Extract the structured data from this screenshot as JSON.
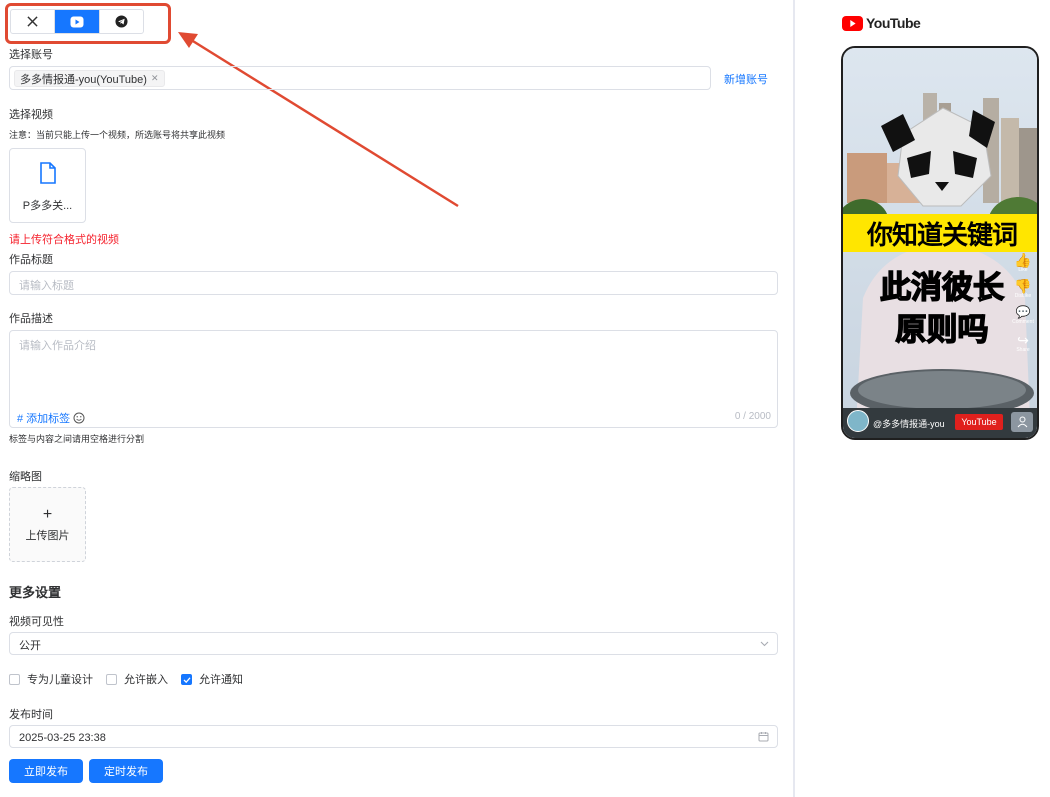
{
  "platforms": [
    {
      "name": "x",
      "icon": "x-logo-icon",
      "active": false
    },
    {
      "name": "youtube",
      "icon": "youtube-play-icon",
      "active": true
    },
    {
      "name": "telegram",
      "icon": "telegram-icon",
      "active": false
    }
  ],
  "account": {
    "label": "选择账号",
    "tag": "多多情报通-you(YouTube)",
    "add_link": "新增账号"
  },
  "video": {
    "label": "选择视频",
    "note": "注意：当前只能上传一个视频，所选账号将共享此视频",
    "file_name": "P多多关...",
    "error": "请上传符合格式的视频"
  },
  "title_field": {
    "label": "作品标题",
    "placeholder": "请输入标题"
  },
  "description": {
    "label": "作品描述",
    "placeholder": "请输入作品介绍",
    "add_tag": "# 添加标签",
    "counter": "0 / 2000",
    "hint": "标签与内容之间请用空格进行分割"
  },
  "thumbnail": {
    "label": "缩略图",
    "upload_plus": "+",
    "upload_text": "上传图片"
  },
  "more_settings": {
    "heading": "更多设置",
    "visibility_label": "视频可见性",
    "visibility_value": "公开",
    "checkboxes": [
      {
        "label": "专为儿童设计",
        "checked": false
      },
      {
        "label": "允许嵌入",
        "checked": false
      },
      {
        "label": "允许通知",
        "checked": true
      }
    ],
    "publish_time_label": "发布时间",
    "publish_time_value": "2025-03-25 23:38"
  },
  "actions": {
    "publish_now": "立即发布",
    "schedule": "定时发布"
  },
  "preview": {
    "brand": "YouTube",
    "overlay_line1": "你知道关键词",
    "overlay_line2": "此消彼长",
    "overlay_line3": "原则吗",
    "side_like": "Like",
    "side_dislike": "DisLike",
    "side_comment": "Comment",
    "side_share": "Share",
    "channel": "@多多情报通-you",
    "badge": "YouTube"
  },
  "colors": {
    "accent": "#1677ff",
    "error": "#f5222d",
    "youtube_red": "#ff0000",
    "annotation": "#e04a32",
    "overlay_yellow": "#ffe600"
  }
}
